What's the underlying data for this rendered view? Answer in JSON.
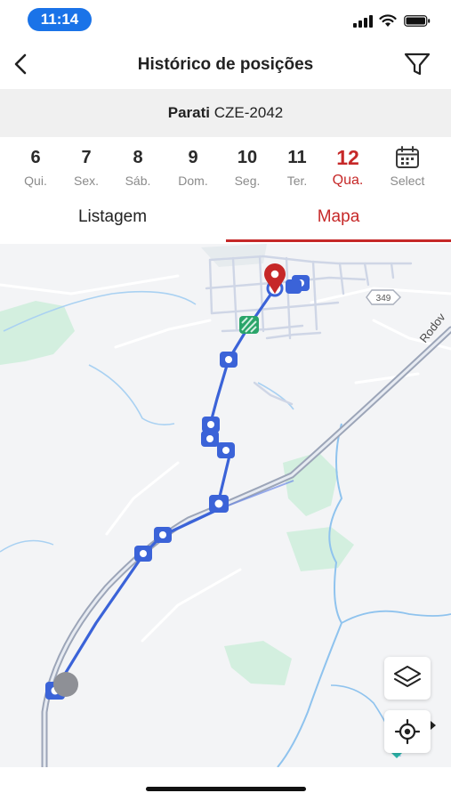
{
  "status_bar": {
    "time": "11:14"
  },
  "header": {
    "title": "Histórico de posições"
  },
  "vehicle": {
    "name": "Parati",
    "plate": "CZE-2042"
  },
  "dates": [
    {
      "num": "6",
      "weekday": "Qui."
    },
    {
      "num": "7",
      "weekday": "Sex."
    },
    {
      "num": "8",
      "weekday": "Sáb."
    },
    {
      "num": "9",
      "weekday": "Dom."
    },
    {
      "num": "10",
      "weekday": "Seg."
    },
    {
      "num": "11",
      "weekday": "Ter."
    },
    {
      "num": "12",
      "weekday": "Qua."
    }
  ],
  "selected_date": "12",
  "select_label": "Select",
  "tabs": {
    "list": "Listagem",
    "map": "Mapa"
  },
  "active_tab": "Mapa",
  "map": {
    "road_shield": "349",
    "road_label": "Rodov",
    "route_color": "#3b63d8",
    "water_color": "#8fc3ee",
    "green_color": "#d3efdf"
  },
  "accent_color": "#c62828"
}
